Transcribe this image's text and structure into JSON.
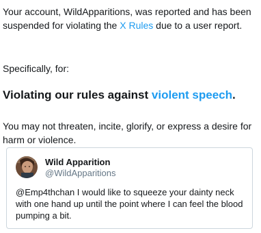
{
  "notice": {
    "intro_before": "Your account, WildApparitions, was reported and has been suspended for violating the ",
    "rules_link": "X Rules",
    "intro_after": " due to a user report.",
    "specifically": "Specifically, for:",
    "headline_before": "Violating our rules against ",
    "headline_link": "violent speech",
    "headline_after": ".",
    "explanation": "You may not threaten, incite, glorify, or express a desire for harm or violence."
  },
  "tweet": {
    "author_name": "Wild Apparition",
    "author_handle": "@WildApparitions",
    "text": "@Emp4thchan I would like to squeeze your dainty neck with one hand up until the point where I can feel the blood pumping a bit."
  },
  "colors": {
    "link": "#1d9bf0",
    "text": "#14171a",
    "secondary": "#657786",
    "border": "#ccd6dd"
  }
}
